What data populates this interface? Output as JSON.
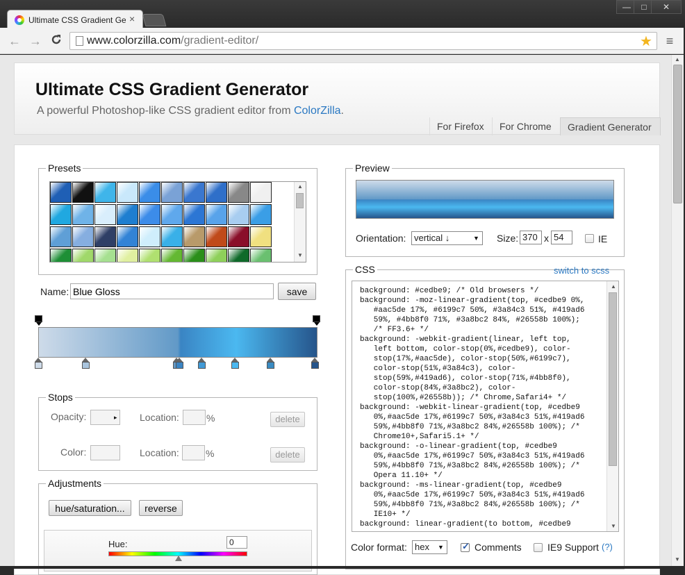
{
  "browser": {
    "tab_title": "Ultimate CSS Gradient Gener",
    "tab_close": "×",
    "url_host": "www.colorzilla.com",
    "url_path": "/gradient-editor/",
    "back": "←",
    "forward": "→",
    "reload": "C",
    "menu": "≡",
    "star": "★",
    "win_min": "—",
    "win_max": "□",
    "win_close": "✕"
  },
  "header": {
    "title": "Ultimate CSS Gradient Generator",
    "subtitle_prefix": "A powerful Photoshop-like CSS gradient editor from ",
    "subtitle_link": "ColorZilla",
    "subtitle_suffix": ".",
    "tabs": [
      "For Firefox",
      "For Chrome",
      "Gradient Generator"
    ]
  },
  "presets": {
    "legend": "Presets",
    "swatches": [
      [
        "#1f5fb5",
        "#111111",
        "#3fb5ea",
        "#c9e8fb",
        "#3a8de8",
        "#7aa2d6",
        "#3a77cf",
        "#2f6fc9",
        "#888888",
        "#f0f0f0"
      ],
      [
        "#20a8e0",
        "#6fb3e8",
        "#d9eefc",
        "#1e7ed0",
        "#3c8ce9",
        "#5fa8ec",
        "#2c76d4",
        "#58a3ea",
        "#a8cdf0",
        "#3a9ee6"
      ],
      [
        "#5f9fd6",
        "#86aee0",
        "#2f3f66",
        "#3283d6",
        "#cfeefc",
        "#39b0e8",
        "#b89a6a",
        "#c04a1a",
        "#8a0f2a",
        "#f0e080"
      ],
      [
        "#1e8f36",
        "#a0d86a",
        "#a6e090",
        "#e0f0a0",
        "#b0e070",
        "#64b832",
        "#2a8f1a",
        "#8ed05a",
        "#0f6a2a",
        "#6ac070"
      ]
    ]
  },
  "name": {
    "label": "Name:",
    "value": "Blue Gloss",
    "save": "save"
  },
  "gradient": {
    "stops": [
      "#cedbe9 0%",
      "#aac5de 17%",
      "#6199c7 50%",
      "#3a84c3 51%",
      "#419ad6 59%",
      "#4bb8f0 71%",
      "#3a8bc2 84%",
      "#26558b 100%"
    ]
  },
  "stops": {
    "legend": "Stops",
    "opacity_label": "Opacity:",
    "location_label": "Location:",
    "color_label": "Color:",
    "percent": "%",
    "delete": "delete"
  },
  "adjustments": {
    "legend": "Adjustments",
    "hue_sat": "hue/saturation...",
    "reverse": "reverse",
    "hue_label": "Hue:",
    "hue_value": "0"
  },
  "preview": {
    "legend": "Preview",
    "orientation_label": "Orientation:",
    "orientation_value": "vertical  ↓",
    "size_label": "Size:",
    "width": "370",
    "x": "x",
    "height": "54",
    "ie_label": "IE"
  },
  "css": {
    "legend": "CSS",
    "switch": "switch to scss",
    "code": "background: #cedbe9; /* Old browsers */\nbackground: -moz-linear-gradient(top, #cedbe9 0%,\n   #aac5de 17%, #6199c7 50%, #3a84c3 51%, #419ad6\n   59%, #4bb8f0 71%, #3a8bc2 84%, #26558b 100%);\n   /* FF3.6+ */\nbackground: -webkit-gradient(linear, left top,\n   left bottom, color-stop(0%,#cedbe9), color-\n   stop(17%,#aac5de), color-stop(50%,#6199c7),\n   color-stop(51%,#3a84c3), color-\n   stop(59%,#419ad6), color-stop(71%,#4bb8f0),\n   color-stop(84%,#3a8bc2), color-\n   stop(100%,#26558b)); /* Chrome,Safari4+ */\nbackground: -webkit-linear-gradient(top, #cedbe9\n   0%,#aac5de 17%,#6199c7 50%,#3a84c3 51%,#419ad6\n   59%,#4bb8f0 71%,#3a8bc2 84%,#26558b 100%); /*\n   Chrome10+,Safari5.1+ */\nbackground: -o-linear-gradient(top, #cedbe9\n   0%,#aac5de 17%,#6199c7 50%,#3a84c3 51%,#419ad6\n   59%,#4bb8f0 71%,#3a8bc2 84%,#26558b 100%); /*\n   Opera 11.10+ */\nbackground: -ms-linear-gradient(top, #cedbe9\n   0%,#aac5de 17%,#6199c7 50%,#3a84c3 51%,#419ad6\n   59%,#4bb8f0 71%,#3a8bc2 84%,#26558b 100%); /*\n   IE10+ */\nbackground: linear-gradient(to bottom, #cedbe9",
    "format_label": "Color format:",
    "format_value": "hex",
    "comments_label": "Comments",
    "ie9_label": "IE9 Support",
    "help": "(?)"
  }
}
